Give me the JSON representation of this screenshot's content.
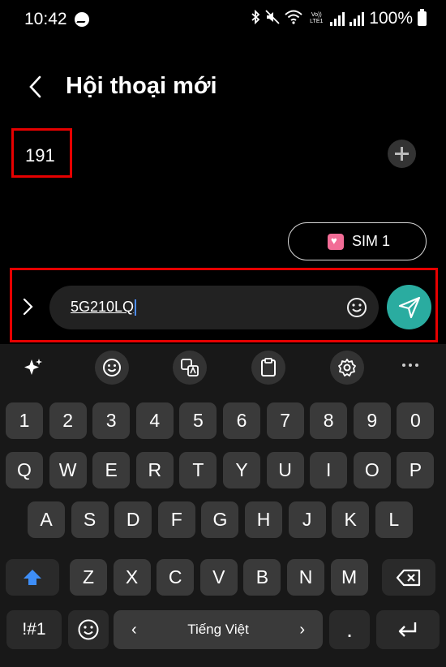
{
  "status_bar": {
    "time": "10:42",
    "battery": "100%",
    "icons": [
      "messenger-icon",
      "bluetooth-icon",
      "mute-icon",
      "wifi-icon",
      "volte-icon",
      "signal-icon",
      "battery-icon"
    ],
    "lte_label": "Vo)) LTE1"
  },
  "header": {
    "title": "Hội thoại mới",
    "back_icon": "chevron-left-icon"
  },
  "recipient": {
    "number": "191",
    "add_icon": "plus-icon"
  },
  "sim": {
    "label": "SIM 1",
    "icon": "heart-sim-icon",
    "accent": "#f26c96"
  },
  "composer": {
    "message": "5G210LQ",
    "emoji_icon": "smiley-icon",
    "expand_icon": "chevron-right-icon",
    "send_icon": "send-icon",
    "send_color": "#2aaca0"
  },
  "keyboard": {
    "toolbar": [
      "sparkle-icon",
      "emoji-icon",
      "translate-icon",
      "clipboard-icon",
      "settings-icon",
      "more-icon"
    ],
    "number_row": [
      "1",
      "2",
      "3",
      "4",
      "5",
      "6",
      "7",
      "8",
      "9",
      "0"
    ],
    "row1": [
      "Q",
      "W",
      "E",
      "R",
      "T",
      "Y",
      "U",
      "I",
      "O",
      "P"
    ],
    "row2": [
      "A",
      "S",
      "D",
      "F",
      "G",
      "H",
      "J",
      "K",
      "L"
    ],
    "row3": [
      "Z",
      "X",
      "C",
      "V",
      "B",
      "N",
      "M"
    ],
    "symbols_key": "!#1",
    "space_label": "Tiếng Việt",
    "space_left": "‹",
    "space_right": "›",
    "period_key": ".",
    "shift_color": "#3e8ef7"
  }
}
